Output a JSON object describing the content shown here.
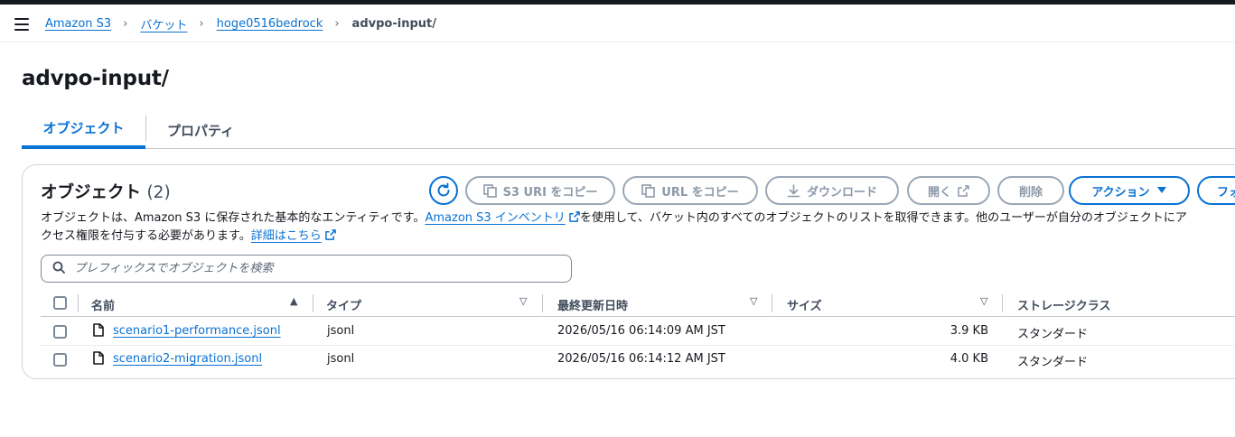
{
  "breadcrumb": {
    "items": [
      "Amazon S3",
      "バケット",
      "hoge0516bedrock"
    ],
    "current": "advpo-input/"
  },
  "page_title": "advpo-input/",
  "tabs": [
    {
      "label": "オブジェクト",
      "active": true
    },
    {
      "label": "プロパティ",
      "active": false
    }
  ],
  "objects_panel": {
    "title": "オブジェクト",
    "count": "(2)",
    "buttons": {
      "copy_s3_uri": "S3 URI をコピー",
      "copy_url": "URL をコピー",
      "download": "ダウンロード",
      "open": "開く",
      "delete": "削除",
      "actions": "アクション",
      "folder_partial": "フォ"
    },
    "description": {
      "part1": "オブジェクトは、Amazon S3 に保存された基本的なエンティティです。",
      "inventory_link": "Amazon S3 インベントリ",
      "part2": "を使用して、バケット内のすべてのオブジェクトのリストを取得できます。他のユーザーが自分のオブジェクトにア",
      "part3": "クセス権限を付与する必要があります。",
      "details_link": "詳細はこちら"
    },
    "search_placeholder": "プレフィックスでオブジェクトを検索",
    "columns": [
      "名前",
      "タイプ",
      "最終更新日時",
      "サイズ",
      "ストレージクラス"
    ],
    "rows": [
      {
        "name": "scenario1-performance.jsonl",
        "type": "jsonl",
        "modified": "2026/05/16 06:14:09 AM JST",
        "size": "3.9 KB",
        "storage_class": "スタンダード"
      },
      {
        "name": "scenario2-migration.jsonl",
        "type": "jsonl",
        "modified": "2026/05/16 06:14:12 AM JST",
        "size": "4.0 KB",
        "storage_class": "スタンダード"
      }
    ]
  },
  "colors": {
    "link": "#0972d3",
    "text": "#16191f",
    "disabled": "#8d99a8",
    "border": "#c6c6cd"
  },
  "icons": [
    "menu-icon",
    "chevron-right-icon",
    "refresh-icon",
    "copy-icon",
    "download-icon",
    "external-link-icon",
    "caret-down-icon",
    "search-icon",
    "sort-ascending-icon",
    "file-icon"
  ]
}
